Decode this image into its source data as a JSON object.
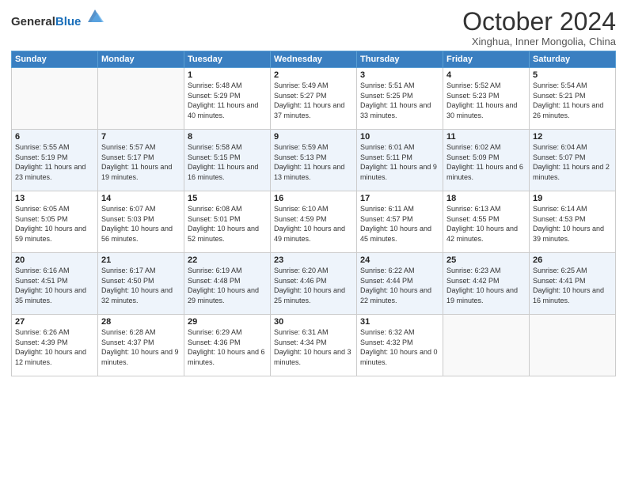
{
  "header": {
    "logo_general": "General",
    "logo_blue": "Blue",
    "title": "October 2024",
    "location": "Xinghua, Inner Mongolia, China"
  },
  "days_of_week": [
    "Sunday",
    "Monday",
    "Tuesday",
    "Wednesday",
    "Thursday",
    "Friday",
    "Saturday"
  ],
  "weeks": [
    [
      {
        "day": "",
        "sunrise": "",
        "sunset": "",
        "daylight": "",
        "empty": true
      },
      {
        "day": "",
        "sunrise": "",
        "sunset": "",
        "daylight": "",
        "empty": true
      },
      {
        "day": "1",
        "sunrise": "Sunrise: 5:48 AM",
        "sunset": "Sunset: 5:29 PM",
        "daylight": "Daylight: 11 hours and 40 minutes."
      },
      {
        "day": "2",
        "sunrise": "Sunrise: 5:49 AM",
        "sunset": "Sunset: 5:27 PM",
        "daylight": "Daylight: 11 hours and 37 minutes."
      },
      {
        "day": "3",
        "sunrise": "Sunrise: 5:51 AM",
        "sunset": "Sunset: 5:25 PM",
        "daylight": "Daylight: 11 hours and 33 minutes."
      },
      {
        "day": "4",
        "sunrise": "Sunrise: 5:52 AM",
        "sunset": "Sunset: 5:23 PM",
        "daylight": "Daylight: 11 hours and 30 minutes."
      },
      {
        "day": "5",
        "sunrise": "Sunrise: 5:54 AM",
        "sunset": "Sunset: 5:21 PM",
        "daylight": "Daylight: 11 hours and 26 minutes."
      }
    ],
    [
      {
        "day": "6",
        "sunrise": "Sunrise: 5:55 AM",
        "sunset": "Sunset: 5:19 PM",
        "daylight": "Daylight: 11 hours and 23 minutes."
      },
      {
        "day": "7",
        "sunrise": "Sunrise: 5:57 AM",
        "sunset": "Sunset: 5:17 PM",
        "daylight": "Daylight: 11 hours and 19 minutes."
      },
      {
        "day": "8",
        "sunrise": "Sunrise: 5:58 AM",
        "sunset": "Sunset: 5:15 PM",
        "daylight": "Daylight: 11 hours and 16 minutes."
      },
      {
        "day": "9",
        "sunrise": "Sunrise: 5:59 AM",
        "sunset": "Sunset: 5:13 PM",
        "daylight": "Daylight: 11 hours and 13 minutes."
      },
      {
        "day": "10",
        "sunrise": "Sunrise: 6:01 AM",
        "sunset": "Sunset: 5:11 PM",
        "daylight": "Daylight: 11 hours and 9 minutes."
      },
      {
        "day": "11",
        "sunrise": "Sunrise: 6:02 AM",
        "sunset": "Sunset: 5:09 PM",
        "daylight": "Daylight: 11 hours and 6 minutes."
      },
      {
        "day": "12",
        "sunrise": "Sunrise: 6:04 AM",
        "sunset": "Sunset: 5:07 PM",
        "daylight": "Daylight: 11 hours and 2 minutes."
      }
    ],
    [
      {
        "day": "13",
        "sunrise": "Sunrise: 6:05 AM",
        "sunset": "Sunset: 5:05 PM",
        "daylight": "Daylight: 10 hours and 59 minutes."
      },
      {
        "day": "14",
        "sunrise": "Sunrise: 6:07 AM",
        "sunset": "Sunset: 5:03 PM",
        "daylight": "Daylight: 10 hours and 56 minutes."
      },
      {
        "day": "15",
        "sunrise": "Sunrise: 6:08 AM",
        "sunset": "Sunset: 5:01 PM",
        "daylight": "Daylight: 10 hours and 52 minutes."
      },
      {
        "day": "16",
        "sunrise": "Sunrise: 6:10 AM",
        "sunset": "Sunset: 4:59 PM",
        "daylight": "Daylight: 10 hours and 49 minutes."
      },
      {
        "day": "17",
        "sunrise": "Sunrise: 6:11 AM",
        "sunset": "Sunset: 4:57 PM",
        "daylight": "Daylight: 10 hours and 45 minutes."
      },
      {
        "day": "18",
        "sunrise": "Sunrise: 6:13 AM",
        "sunset": "Sunset: 4:55 PM",
        "daylight": "Daylight: 10 hours and 42 minutes."
      },
      {
        "day": "19",
        "sunrise": "Sunrise: 6:14 AM",
        "sunset": "Sunset: 4:53 PM",
        "daylight": "Daylight: 10 hours and 39 minutes."
      }
    ],
    [
      {
        "day": "20",
        "sunrise": "Sunrise: 6:16 AM",
        "sunset": "Sunset: 4:51 PM",
        "daylight": "Daylight: 10 hours and 35 minutes."
      },
      {
        "day": "21",
        "sunrise": "Sunrise: 6:17 AM",
        "sunset": "Sunset: 4:50 PM",
        "daylight": "Daylight: 10 hours and 32 minutes."
      },
      {
        "day": "22",
        "sunrise": "Sunrise: 6:19 AM",
        "sunset": "Sunset: 4:48 PM",
        "daylight": "Daylight: 10 hours and 29 minutes."
      },
      {
        "day": "23",
        "sunrise": "Sunrise: 6:20 AM",
        "sunset": "Sunset: 4:46 PM",
        "daylight": "Daylight: 10 hours and 25 minutes."
      },
      {
        "day": "24",
        "sunrise": "Sunrise: 6:22 AM",
        "sunset": "Sunset: 4:44 PM",
        "daylight": "Daylight: 10 hours and 22 minutes."
      },
      {
        "day": "25",
        "sunrise": "Sunrise: 6:23 AM",
        "sunset": "Sunset: 4:42 PM",
        "daylight": "Daylight: 10 hours and 19 minutes."
      },
      {
        "day": "26",
        "sunrise": "Sunrise: 6:25 AM",
        "sunset": "Sunset: 4:41 PM",
        "daylight": "Daylight: 10 hours and 16 minutes."
      }
    ],
    [
      {
        "day": "27",
        "sunrise": "Sunrise: 6:26 AM",
        "sunset": "Sunset: 4:39 PM",
        "daylight": "Daylight: 10 hours and 12 minutes."
      },
      {
        "day": "28",
        "sunrise": "Sunrise: 6:28 AM",
        "sunset": "Sunset: 4:37 PM",
        "daylight": "Daylight: 10 hours and 9 minutes."
      },
      {
        "day": "29",
        "sunrise": "Sunrise: 6:29 AM",
        "sunset": "Sunset: 4:36 PM",
        "daylight": "Daylight: 10 hours and 6 minutes."
      },
      {
        "day": "30",
        "sunrise": "Sunrise: 6:31 AM",
        "sunset": "Sunset: 4:34 PM",
        "daylight": "Daylight: 10 hours and 3 minutes."
      },
      {
        "day": "31",
        "sunrise": "Sunrise: 6:32 AM",
        "sunset": "Sunset: 4:32 PM",
        "daylight": "Daylight: 10 hours and 0 minutes."
      },
      {
        "day": "",
        "sunrise": "",
        "sunset": "",
        "daylight": "",
        "empty": true
      },
      {
        "day": "",
        "sunrise": "",
        "sunset": "",
        "daylight": "",
        "empty": true
      }
    ]
  ]
}
